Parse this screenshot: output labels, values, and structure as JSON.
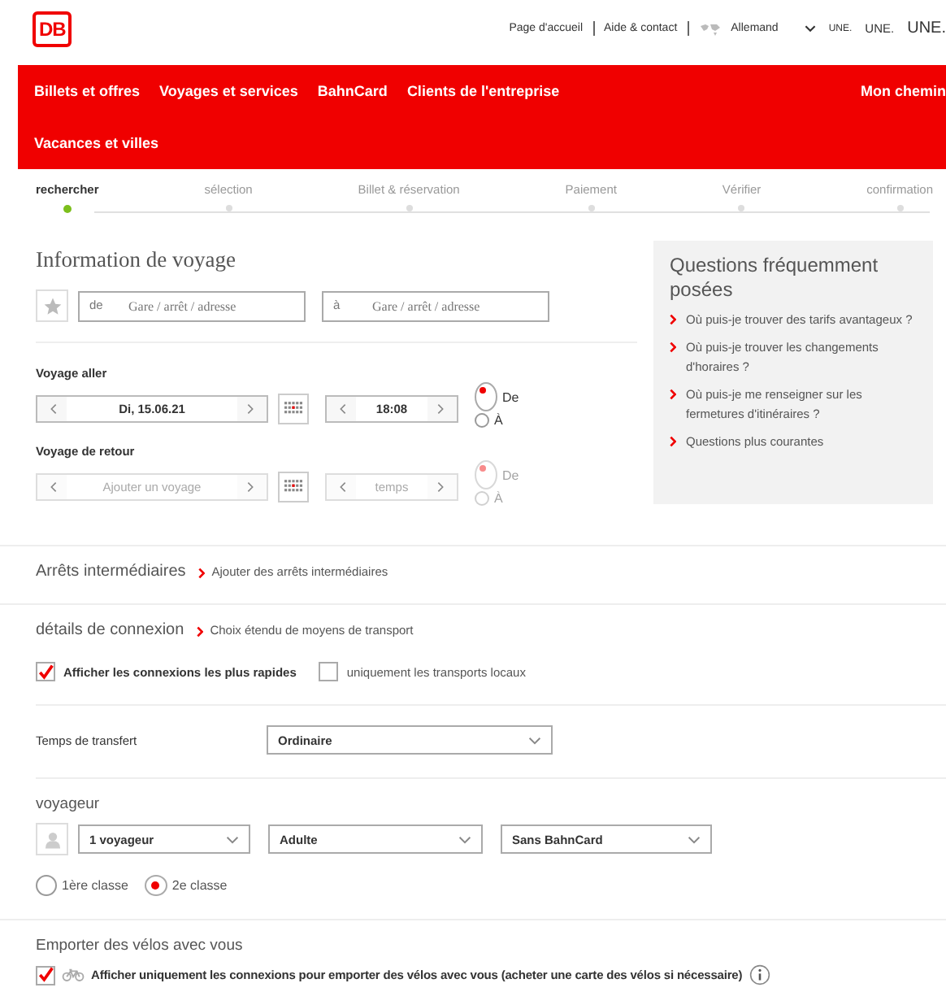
{
  "header": {
    "logo": "DB",
    "links": [
      "Page d'accueil",
      "Aide & contact"
    ],
    "language": "Allemand",
    "text_sizes": [
      "UNE.",
      "UNE.",
      "UNE."
    ]
  },
  "nav": {
    "items": [
      "Billets et offres",
      "Voyages et services",
      "BahnCard",
      "Clients de l'entreprise"
    ],
    "right": "Mon chemin",
    "second_row": [
      "Vacances et villes"
    ]
  },
  "steps": [
    {
      "label": "rechercher",
      "selected": true
    },
    {
      "label": "sélection",
      "selected": false
    },
    {
      "label": "Billet & réservation",
      "selected": false
    },
    {
      "label": "Paiement",
      "selected": false
    },
    {
      "label": "Vérifier",
      "selected": false
    },
    {
      "label": "confirmation",
      "selected": false
    }
  ],
  "trip": {
    "title": "Information de voyage",
    "from": {
      "prefix": "de",
      "placeholder": "Gare / arrêt / adresse"
    },
    "to": {
      "prefix": "à",
      "placeholder": "Gare / arrêt / adresse"
    }
  },
  "journeys": [
    {
      "label": "Voyage aller",
      "date": "Di, 15.06.21",
      "time": "18:08",
      "disabled": false,
      "options": [
        {
          "label": "De",
          "selected": true
        },
        {
          "label": "À",
          "selected": false
        }
      ]
    },
    {
      "label": "Voyage de retour",
      "date": "Ajouter un voyage",
      "time": "temps",
      "disabled": true,
      "options": [
        {
          "label": "De",
          "selected": true
        },
        {
          "label": "À",
          "selected": false
        }
      ]
    }
  ],
  "faq": {
    "title": "Questions fréquemment posées",
    "items": [
      "Où puis-je trouver des tarifs avantageux ?",
      "Où puis-je trouver les changements d'horaires ?",
      "Où puis-je me renseigner sur les fermetures d'itinéraires ?",
      "Questions plus courantes"
    ]
  },
  "stops": {
    "label": "Arrêts intermédiaires",
    "link": "Ajouter des arrêts intermédiaires"
  },
  "connection": {
    "label": "détails de connexion",
    "link": "Choix étendu de moyens de transport",
    "checks": [
      {
        "label": "Afficher les connexions les plus rapides",
        "checked": true
      },
      {
        "label": "uniquement les transports locaux",
        "checked": false
      }
    ]
  },
  "transfer": {
    "label": "Temps de transfert",
    "value": "Ordinaire"
  },
  "travellers": {
    "label": "voyageur",
    "selects": [
      "1 voyageur",
      "Adulte",
      "Sans BahnCard"
    ],
    "classes": [
      {
        "label": "1ère classe",
        "selected": false
      },
      {
        "label": "2e classe",
        "selected": true
      }
    ]
  },
  "bikes": {
    "title": "Emporter des vélos avec vous",
    "label": "Afficher uniquement les connexions pour emporter des vélos avec vous (acheter une carte des vélos si nécessaire)",
    "checked": true
  }
}
